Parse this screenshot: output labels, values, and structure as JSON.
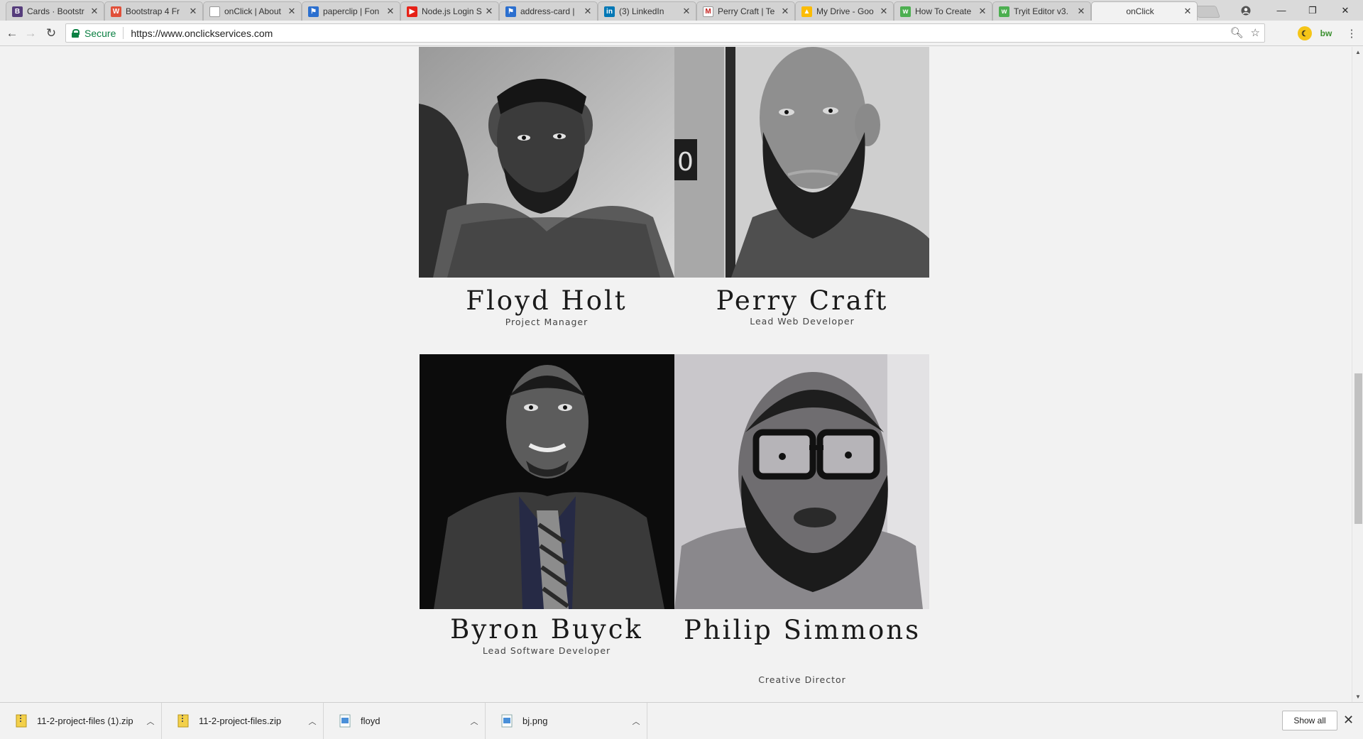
{
  "tabs": [
    {
      "title": "Cards · Bootstr",
      "icon": "bootstrap-icon",
      "color": "#563d7c",
      "glyph": "B"
    },
    {
      "title": "Bootstrap 4 Fr",
      "icon": "bootstrap4-icon",
      "color": "#e0503a",
      "glyph": "W"
    },
    {
      "title": "onClick | About",
      "icon": "page-icon",
      "color": "#ffffff",
      "glyph": ""
    },
    {
      "title": "paperclip | Fon",
      "icon": "flag-icon",
      "color": "#2b6fcf",
      "glyph": "⚑"
    },
    {
      "title": "Node.js Login S",
      "icon": "youtube-icon",
      "color": "#e62117",
      "glyph": "▶"
    },
    {
      "title": "address-card |",
      "icon": "flag-icon",
      "color": "#2b6fcf",
      "glyph": "⚑"
    },
    {
      "title": "(3) LinkedIn",
      "icon": "linkedin-icon",
      "color": "#0077b5",
      "glyph": "in"
    },
    {
      "title": "Perry Craft | Te",
      "icon": "gmail-icon",
      "color": "#ffffff",
      "glyph": "M"
    },
    {
      "title": "My Drive - Goo",
      "icon": "drive-icon",
      "color": "#fbbc05",
      "glyph": "▲"
    },
    {
      "title": "How To Create",
      "icon": "w3schools-icon",
      "color": "#4caf50",
      "glyph": "w"
    },
    {
      "title": "Tryit Editor v3.",
      "icon": "w3schools-icon",
      "color": "#4caf50",
      "glyph": "w"
    },
    {
      "title": "onClick",
      "icon": "",
      "color": "",
      "glyph": ""
    }
  ],
  "address": {
    "secure_label": "Secure",
    "url": "https://www.onclickservices.com"
  },
  "team": [
    {
      "name": "Floyd Holt",
      "role": "Project Manager"
    },
    {
      "name": "Perry Craft",
      "role": "Lead Web Developer"
    },
    {
      "name": "Byron Buyck",
      "role": "Lead Software Developer"
    },
    {
      "name": "Philip Simmons",
      "role": "Creative Director"
    }
  ],
  "downloads": [
    {
      "name": "11-2-project-files (1).zip",
      "icon": "zip-file-icon"
    },
    {
      "name": "11-2-project-files.zip",
      "icon": "zip-file-icon"
    },
    {
      "name": "floyd",
      "icon": "image-file-icon"
    },
    {
      "name": "bj.png",
      "icon": "image-file-icon"
    }
  ],
  "shelf": {
    "show_all": "Show all"
  }
}
